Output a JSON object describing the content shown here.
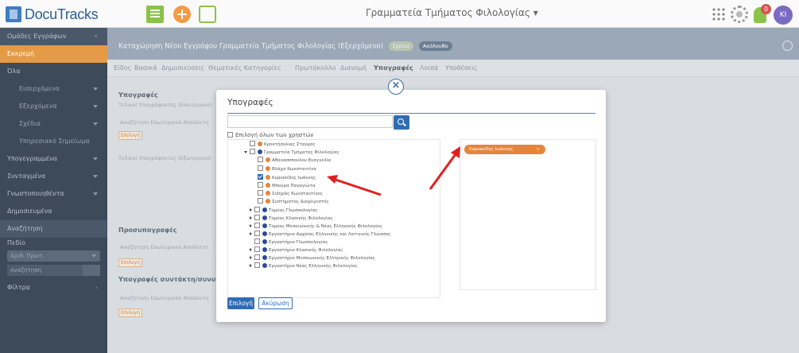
{
  "app": {
    "logo_text": "DocuTracks",
    "title": "Γραμματεία Τμήματος Φιλολογίας ▾"
  },
  "topbar": {
    "notifications": "0",
    "avatar_initials": "ΚΙ"
  },
  "sidebar": {
    "header": "Ομάδες Εγγράφων",
    "collapse": "«",
    "items": [
      {
        "label": "Εκκρεμή"
      },
      {
        "label": "Όλα"
      },
      {
        "label": "Εισερχόμενα"
      },
      {
        "label": "Εξερχόμενα"
      },
      {
        "label": "Σχέδια"
      },
      {
        "label": "Υπηρεσιακό Σημείωμα"
      },
      {
        "label": "Υπογεγραμμένα"
      },
      {
        "label": "Συνταγμένα"
      },
      {
        "label": "Γνωστοποιηθέντα"
      },
      {
        "label": "Δημοσιευμένα"
      },
      {
        "label": "Αναζήτηση"
      },
      {
        "label": "Πεδίο"
      },
      {
        "label": "Φίλτρα"
      }
    ],
    "field_select": "Αριθ. Πρωτ.",
    "search_placeholder": "Αναζήτηση"
  },
  "page": {
    "title": "Καταχώρηση Νέου Εγγράφου Γραμματεία Τμήματος Φιλολογίας (Εξερχόμενο)",
    "chip1": "Σχέδιο",
    "chip2": "Ακόλουθο"
  },
  "tabs": [
    "Είδος",
    "Βασικά",
    "Δημοσιεύσεις",
    "Θεματικές Κατηγορίες",
    "Πρωτόκολλο",
    "Διανομή",
    "Υπογραφές",
    "Λοιπά",
    "Υποθέσεις"
  ],
  "content": {
    "section_signatures": "Υπογραφές",
    "internal_signers": "Τελικοί Υπογράφοντες (Εσωτερικοί)",
    "search_internal": "Αναζήτηση Εσωτερικού Αποδέκτη",
    "select_btn": "Επιλογή",
    "external_signers": "Τελικοί Υπογράφοντες (Εξωτερικοί)",
    "pre_signatures": "Προσυπογραφές",
    "search_pre": "Αναζήτηση Εσωτερικού Αποδέκτη",
    "select_btn2": "Επιλογή",
    "author_signatures": "Υπογραφές συντάκτη/συνυπ",
    "search_author": "Αναζήτηση Εσωτερικού Αποδέκτη",
    "select_btn3": "Επιλογή"
  },
  "modal": {
    "title": "Υπογραφές",
    "search_value": "",
    "select_all": "Επιλογή όλων των χρηστών",
    "tree": [
      {
        "label": "Κροντήσολιας Σταύρος",
        "type": "person"
      },
      {
        "label": "Γραμματεία Τμήματος Φιλολογίας",
        "type": "unit"
      },
      {
        "label": "Αθανασοπούλου Ευαγγελία",
        "type": "person"
      },
      {
        "label": "Βλάχα Κωνσταντίνα",
        "type": "person"
      },
      {
        "label": "Κυριακίδης Ιωάννης",
        "type": "person",
        "checked": true
      },
      {
        "label": "Μπούρα Παναγιώτα",
        "type": "person"
      },
      {
        "label": "Σιδηράς Κωνσταντίνος",
        "type": "person"
      },
      {
        "label": "Συστήματος Διαχειριστής",
        "type": "person"
      },
      {
        "label": "Τομέας Γλωσσολογίας",
        "type": "unit"
      },
      {
        "label": "Τομέας Κλασικής Φιλολογίας",
        "type": "unit"
      },
      {
        "label": "Τομέας Μεσαιωνικής & Νέας Ελληνικής Φιλολογίας",
        "type": "unit"
      },
      {
        "label": "Εργαστήριο Αρχαίας Ελληνικής και Λατινικής Γλώσσας",
        "type": "unit"
      },
      {
        "label": "Εργαστήριο Γλωσσολογίας",
        "type": "unit"
      },
      {
        "label": "Εργαστήριο Κλασικής Φιλολογίας",
        "type": "unit"
      },
      {
        "label": "Εργαστήριο Μεσαιωνικής Ελληνικής Φιλολογίας",
        "type": "unit"
      },
      {
        "label": "Εργαστήριο Νέας Ελληνικής Φιλολογίας",
        "type": "unit"
      }
    ],
    "selected": [
      {
        "label": "Κυριακίδης Ιωάννης",
        "remove": "×"
      }
    ],
    "btn_select": "Επιλογή",
    "btn_cancel": "Ακύρωση",
    "close": "×"
  },
  "colors": {
    "accent": "#e59a46",
    "primary": "#2f6db3",
    "sidebar": "#3d4a59",
    "arrow": "#e02020"
  }
}
